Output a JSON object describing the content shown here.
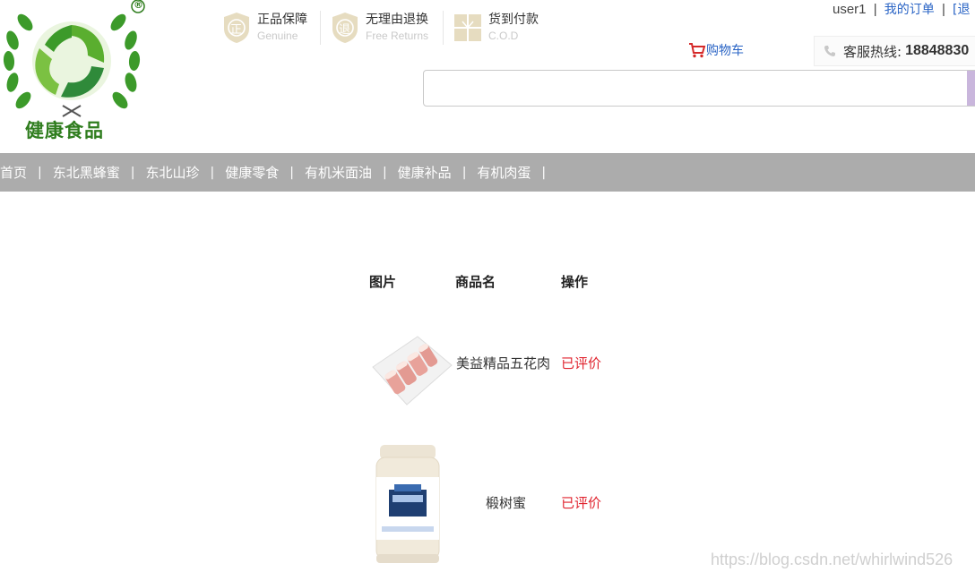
{
  "logo": {
    "text": "健康食品",
    "registered": "®"
  },
  "promises": [
    {
      "icon": "genuine-shield-icon",
      "glyph": "正",
      "title": "正品保障",
      "subtitle": "Genuine"
    },
    {
      "icon": "return-shield-icon",
      "glyph": "退",
      "title": "无理由退换",
      "subtitle": "Free Returns"
    },
    {
      "icon": "gift-icon",
      "glyph": "",
      "title": "货到付款",
      "subtitle": "C.O.D"
    }
  ],
  "userbar": {
    "username": "user1",
    "sep": "|",
    "my_orders": "我的订单",
    "sep2": "|",
    "next": "[退"
  },
  "cart": {
    "label": "购物车"
  },
  "hotline": {
    "label": "客服热线:",
    "number": "18848830"
  },
  "search": {
    "placeholder": ""
  },
  "nav": {
    "items": [
      "首页",
      "东北黑蜂蜜",
      "东北山珍",
      "健康零食",
      "有机米面油",
      "健康补品",
      "有机肉蛋"
    ],
    "sep": "|"
  },
  "table": {
    "headers": {
      "image": "图片",
      "name": "商品名",
      "action": "操作"
    },
    "rows": [
      {
        "name": "美益精品五花肉",
        "action": "已评价",
        "image": "pork-belly-image"
      },
      {
        "name": "椴树蜜",
        "action": "已评价",
        "image": "honey-jar-image"
      }
    ]
  },
  "watermark": "https://blog.csdn.net/whirlwind526",
  "colors": {
    "nav_bg": "#acacac",
    "link": "#2a64c5",
    "action_red": "#e0232e",
    "logo_green": "#2f7d1e"
  }
}
